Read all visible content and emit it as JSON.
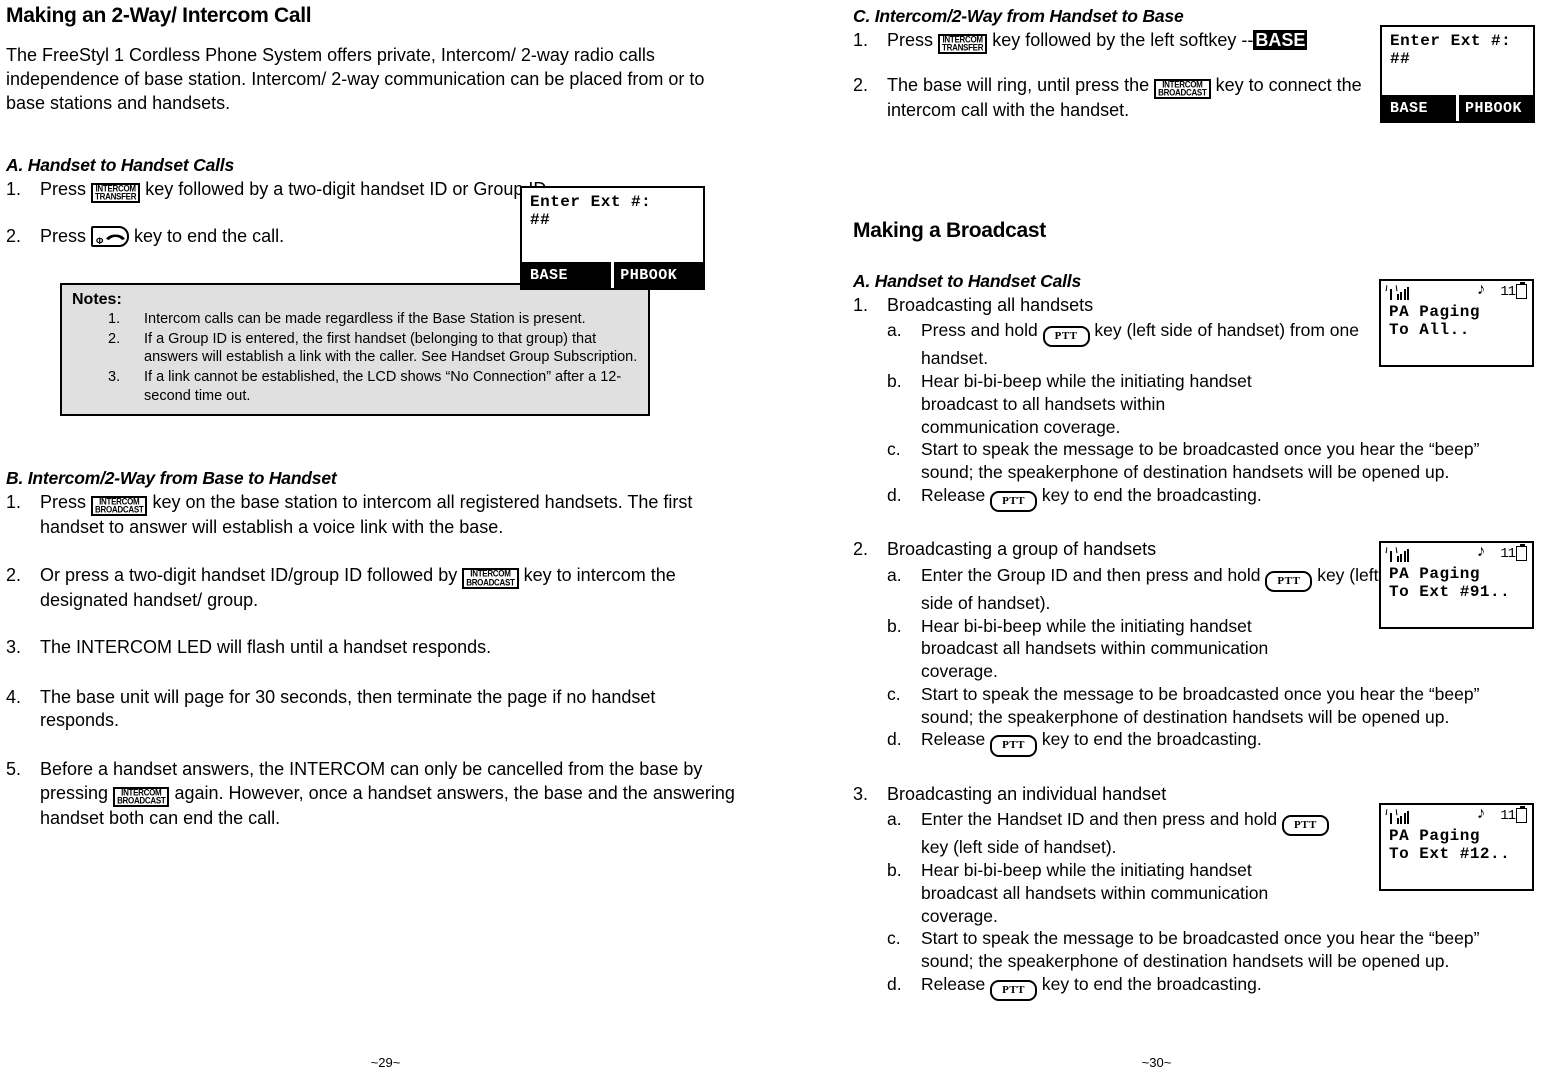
{
  "left_page": {
    "title": "Making an 2-Way/ Intercom Call",
    "intro": "The FreeStyl 1 Cordless Phone System offers private, Intercom/ 2-way radio calls independence of base station.  Intercom/ 2-way communication can be placed from or to base stations and handsets.",
    "section_a": {
      "heading": "A. Handset to Handset Calls",
      "step1_marker": "1.",
      "step1_before": "Press",
      "step1_key": {
        "line1": "INTERCOM",
        "line2": "TRANSFER"
      },
      "step1_after": "key followed by a two-digit handset ID or Group ID.",
      "step2_marker": "2.",
      "step2_before": "Press",
      "step2_key_power": "Φ",
      "step2_after": "key to end the call."
    },
    "lcd_a": {
      "line1": "Enter Ext #:",
      "line2": "##",
      "softkey_left": "BASE",
      "softkey_right": "PHBOOK"
    },
    "notes": {
      "title": "Notes:",
      "items": [
        {
          "marker": "1.",
          "text": "Intercom calls can be made regardless if the Base Station is present."
        },
        {
          "marker": "2.",
          "text": "If a Group ID is entered, the first handset (belonging to that group) that answers will establish a link with the caller.  See Handset Group Subscription."
        },
        {
          "marker": "3.",
          "text": "If a link cannot be established, the LCD shows “No Connection” after a 12-second time out."
        }
      ]
    },
    "section_b": {
      "heading": "B. Intercom/2-Way from Base to Handset",
      "step1_marker": "1.",
      "step1_before": "Press",
      "step1_key": {
        "line1": "INTERCOM",
        "line2": "BROADCAST"
      },
      "step1_after": "key on the base station to intercom all registered handsets. The first handset to answer will establish a voice link with the base.",
      "step2_marker": "2.",
      "step2_before": "Or press a two-digit handset ID/group ID followed by",
      "step2_key": {
        "line1": "INTERCOM",
        "line2": "BROADCAST"
      },
      "step2_after": "key to intercom the designated handset/ group.",
      "step3_marker": "3.",
      "step3_text": "The INTERCOM LED will flash until a handset responds.",
      "step4_marker": "4.",
      "step4_text": "The base unit will page for 30 seconds, then terminate the page if no handset responds.",
      "step5_marker": "5.",
      "step5_before": "Before a handset answers, the INTERCOM can only be cancelled from the base by pressing",
      "step5_key": {
        "line1": "INTERCOM",
        "line2": "BROADCAST"
      },
      "step5_after": "again. However, once a handset answers, the base and the answering handset both can end the call."
    },
    "footer": "~29~"
  },
  "right_page": {
    "section_c": {
      "heading": "C. Intercom/2-Way from Handset to Base",
      "step1_marker": "1.",
      "step1_before": "Press",
      "step1_key": {
        "line1": "INTERCOM",
        "line2": "TRANSFER"
      },
      "step1_mid": "key followed by the left softkey --",
      "step1_highlight": "BASE",
      "step2_marker": "2.",
      "step2_before": "The base will ring, until press the",
      "step2_key": {
        "line1": "INTERCOM",
        "line2": "BROADCAST"
      },
      "step2_after": "key to connect the intercom call with the handset."
    },
    "lcd_c": {
      "line1": "Enter Ext #:",
      "line2": "##",
      "softkey_left": "BASE",
      "softkey_right": "PHBOOK"
    },
    "broadcast": {
      "title": "Making a Broadcast",
      "heading_a": "A. Handset to Handset Calls",
      "groups": [
        {
          "marker": "1.",
          "title": "Broadcasting all handsets",
          "substeps": [
            {
              "marker": "a.",
              "before": "Press and hold",
              "key": "PTT",
              "after": "key (left side of handset) from one handset."
            },
            {
              "marker": "b.",
              "text": "Hear bi-bi-beep while the initiating handset broadcast to all handsets within communication coverage."
            },
            {
              "marker": "c.",
              "text": "Start to speak the message to be broadcasted once you hear the “beep” sound; the speakerphone of destination handsets will be opened up."
            },
            {
              "marker": "d.",
              "before": "Release",
              "key": "PTT",
              "after": "key to end the broadcasting."
            }
          ],
          "lcd": {
            "channel": "11",
            "line1": "PA Paging",
            "line2": "To All.."
          }
        },
        {
          "marker": "2.",
          "title": "Broadcasting a group of handsets",
          "substeps": [
            {
              "marker": "a.",
              "before": "Enter the Group ID and then press and hold",
              "key": "PTT",
              "after": "key (left side of handset)."
            },
            {
              "marker": "b.",
              "text": "Hear bi-bi-beep while the initiating handset broadcast all handsets within communication coverage."
            },
            {
              "marker": "c.",
              "text": "Start to speak the message to be broadcasted once you hear the “beep” sound; the speakerphone of destination handsets will be opened up."
            },
            {
              "marker": "d.",
              "before": "Release",
              "key": "PTT",
              "after": "key to end the broadcasting."
            }
          ],
          "lcd": {
            "channel": "11",
            "line1": "PA Paging",
            "line2": "To Ext #91.."
          }
        },
        {
          "marker": "3.",
          "title": "Broadcasting an individual handset",
          "substeps": [
            {
              "marker": "a.",
              "before": "Enter the Handset ID and then press and hold",
              "key": "PTT",
              "after": "key (left side of handset)."
            },
            {
              "marker": "b.",
              "text": "Hear bi-bi-beep while the initiating handset broadcast all handsets within communication coverage."
            },
            {
              "marker": "c.",
              "text": "Start to speak the message to be broadcasted once you hear the “beep” sound; the speakerphone of destination handsets will be opened up."
            },
            {
              "marker": "d.",
              "before": "Release",
              "key": "PTT",
              "after": "key to end the broadcasting."
            }
          ],
          "lcd": {
            "channel": "11",
            "line1": "PA Paging",
            "line2": "To Ext #12.."
          }
        }
      ]
    },
    "footer": "~30~"
  }
}
